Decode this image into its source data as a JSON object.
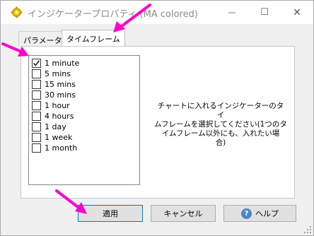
{
  "window": {
    "title": "インジケータープロパティ (MA colored)",
    "minimize_glyph": "—",
    "maximize_glyph": "☐",
    "close_glyph": "✕"
  },
  "tabs": [
    {
      "label": "パラメーター",
      "active": false
    },
    {
      "label": "タイムフレーム",
      "active": true
    }
  ],
  "timeframes": [
    {
      "label": "1 minute",
      "checked": true
    },
    {
      "label": "5 mins",
      "checked": false
    },
    {
      "label": "15 mins",
      "checked": false
    },
    {
      "label": "30 mins",
      "checked": false
    },
    {
      "label": "1 hour",
      "checked": false
    },
    {
      "label": "4 hours",
      "checked": false
    },
    {
      "label": "1 day",
      "checked": false
    },
    {
      "label": "1 week",
      "checked": false
    },
    {
      "label": "1 month",
      "checked": false
    }
  ],
  "description": {
    "lines": [
      "チャートに入れるインジケーターのタイ",
      "ムフレームを選択してください(1つのタ",
      "イムフレーム以外にも、入れたい場",
      "合)"
    ]
  },
  "buttons": {
    "apply": "適用",
    "cancel": "キャンセル",
    "help": "ヘルプ",
    "help_icon_glyph": "?"
  },
  "colors": {
    "annotation_arrow": "#ff00cc",
    "default_button_border": "#0078d7",
    "help_icon": "#4a86c5"
  },
  "icons": {
    "app": "gear-icon",
    "annotation": "arrow-icon"
  }
}
